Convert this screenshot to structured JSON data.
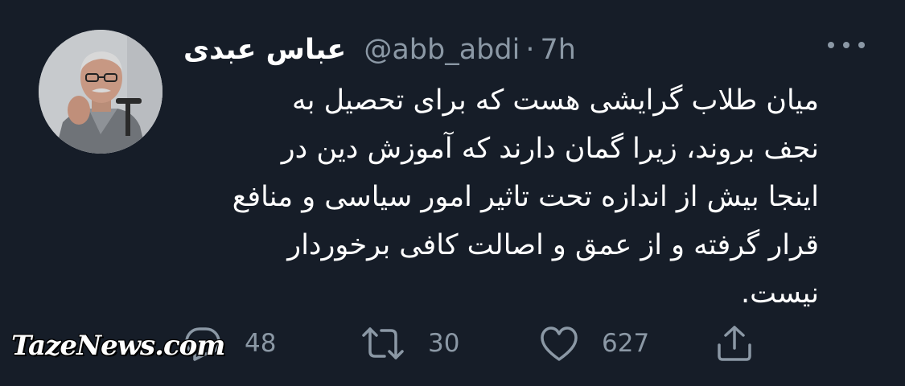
{
  "tweet": {
    "author_name": "عباس عبدی",
    "handle": "@abb_abdi",
    "separator": "·",
    "time": "7h",
    "lines": [
      "میان طلاب گرایشی هست که برای تحصیل به",
      "نجف بروند، زیرا گمان دارند که آموزش دین در",
      "اینجا بیش از اندازه تحت تاثیر امور سیاسی و منافع",
      "قرار گرفته و از عمق و اصالت کافی برخوردار",
      "نیست."
    ]
  },
  "actions": {
    "reply_count": "48",
    "retweet_count": "30",
    "like_count": "627"
  },
  "watermark": "TazeNews.com",
  "icons": {
    "more": "more-horizontal-icon",
    "reply": "reply-icon",
    "retweet": "retweet-icon",
    "like": "heart-icon",
    "share": "share-icon"
  },
  "colors": {
    "background": "#161d28",
    "secondary_text": "#8b98a5",
    "primary_text": "#ffffff"
  }
}
